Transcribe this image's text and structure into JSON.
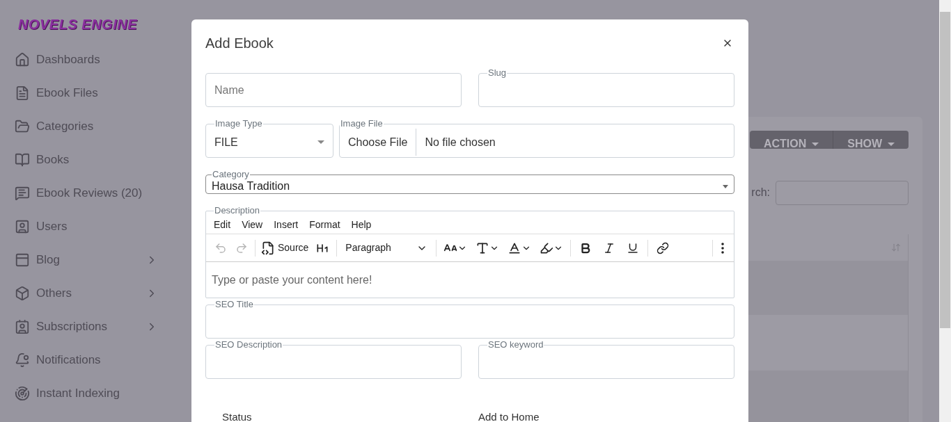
{
  "sidebar": {
    "logo": "NOVELS ENGINE",
    "items": [
      {
        "label": "Dashboards",
        "kind": "home",
        "has_submenu": false
      },
      {
        "label": "Ebook Files",
        "kind": "file",
        "has_submenu": false
      },
      {
        "label": "Categories",
        "kind": "folder",
        "has_submenu": false
      },
      {
        "label": "Books",
        "kind": "book",
        "has_submenu": false
      },
      {
        "label": "Ebook Reviews (20)",
        "kind": "reviews",
        "has_submenu": false
      },
      {
        "label": "Users",
        "kind": "users",
        "has_submenu": false
      },
      {
        "label": "Blog",
        "kind": "blog",
        "has_submenu": true
      },
      {
        "label": "Others",
        "kind": "box",
        "has_submenu": true
      },
      {
        "label": "Subscriptions",
        "kind": "subscriptions",
        "has_submenu": true
      },
      {
        "label": "Notifications",
        "kind": "bell",
        "has_submenu": false
      },
      {
        "label": "Instant Indexing",
        "kind": "indexing",
        "has_submenu": false
      }
    ]
  },
  "background": {
    "buttons": [
      "ACTION",
      "SHOW"
    ],
    "search_label": "rch:"
  },
  "modal": {
    "title": "Add Ebook",
    "name": {
      "placeholder": "Name"
    },
    "slug": {
      "label": "Slug"
    },
    "image_type": {
      "label": "Image Type",
      "value": "FILE"
    },
    "image_file": {
      "label": "Image File",
      "button": "Choose File",
      "status": "No file chosen"
    },
    "category": {
      "label": "Category",
      "value": "Hausa Tradition"
    },
    "description": {
      "label": "Description",
      "menu": [
        "Edit",
        "View",
        "Insert",
        "Format",
        "Help"
      ],
      "toolbar": [
        {
          "kind": "undo",
          "disabled": true
        },
        {
          "kind": "redo",
          "disabled": true
        },
        {
          "kind": "separator"
        },
        {
          "kind": "source",
          "label": "Source"
        },
        {
          "kind": "heading"
        },
        {
          "kind": "separator"
        },
        {
          "kind": "block",
          "label": "Paragraph"
        },
        {
          "kind": "separator"
        },
        {
          "kind": "size"
        },
        {
          "kind": "style"
        },
        {
          "kind": "color"
        },
        {
          "kind": "highlight"
        },
        {
          "kind": "separator"
        },
        {
          "kind": "bold"
        },
        {
          "kind": "italic"
        },
        {
          "kind": "underline"
        },
        {
          "kind": "separator"
        },
        {
          "kind": "link"
        },
        {
          "kind": "spacer"
        },
        {
          "kind": "separator"
        },
        {
          "kind": "more"
        }
      ],
      "placeholder": "Type or paste your content here!"
    },
    "seo_title": {
      "label": "SEO Title"
    },
    "seo_description": {
      "label": "SEO Description"
    },
    "seo_keyword": {
      "label": "SEO keyword"
    },
    "bottom_labels": [
      "Status",
      "Add to Home"
    ]
  }
}
